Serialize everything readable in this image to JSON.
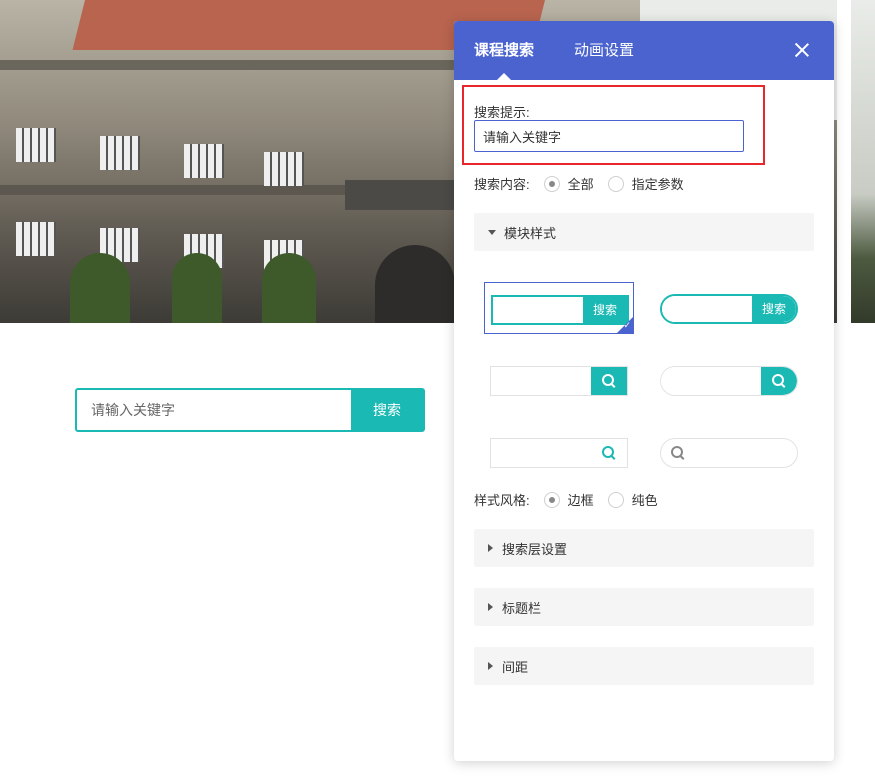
{
  "preview": {
    "search_placeholder": "请输入关键字",
    "search_button": "搜索"
  },
  "panel": {
    "tabs": [
      {
        "label": "课程搜索",
        "active": true
      },
      {
        "label": "动画设置",
        "active": false
      }
    ],
    "search_hint_label": "搜索提示:",
    "search_hint_value": "请输入关键字",
    "search_content_label": "搜索内容:",
    "search_content_options": [
      {
        "label": "全部",
        "selected": true
      },
      {
        "label": "指定参数",
        "selected": false
      }
    ],
    "module_style_section": "模块样式",
    "style_buttons": [
      "搜索",
      "搜索"
    ],
    "style_mode_label": "样式风格:",
    "style_mode_options": [
      {
        "label": "边框",
        "selected": true
      },
      {
        "label": "纯色",
        "selected": false
      }
    ],
    "sections": [
      "搜索层设置",
      "标题栏",
      "间距"
    ]
  },
  "colors": {
    "header": "#4a63cf",
    "accent": "#1bb9b4",
    "highlight": "#e8262c"
  }
}
